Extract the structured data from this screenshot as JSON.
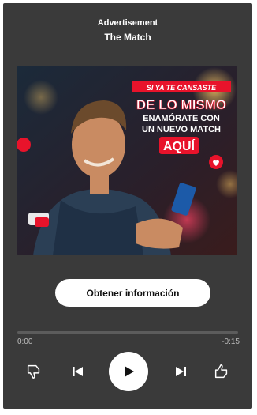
{
  "header": {
    "label": "Advertisement",
    "title": "The Match"
  },
  "ad": {
    "headline_1": "SI YA TE CANSASTE",
    "headline_2": "DE LO MISMO",
    "headline_3": "ENAMÓRATE CON",
    "headline_4": "UN NUEVO MATCH",
    "cta_badge": "AQUÍ"
  },
  "cta": {
    "label": "Obtener información"
  },
  "player": {
    "elapsed": "0:00",
    "remaining": "-0:15",
    "progress": 0.0
  },
  "icons": {
    "dislike": "thumbs-down-icon",
    "previous": "skip-previous-icon",
    "play": "play-icon",
    "next": "skip-next-icon",
    "like": "thumbs-up-icon"
  },
  "colors": {
    "background": "#3a3a3a",
    "accent_red": "#e8132b",
    "text": "#ffffff"
  }
}
